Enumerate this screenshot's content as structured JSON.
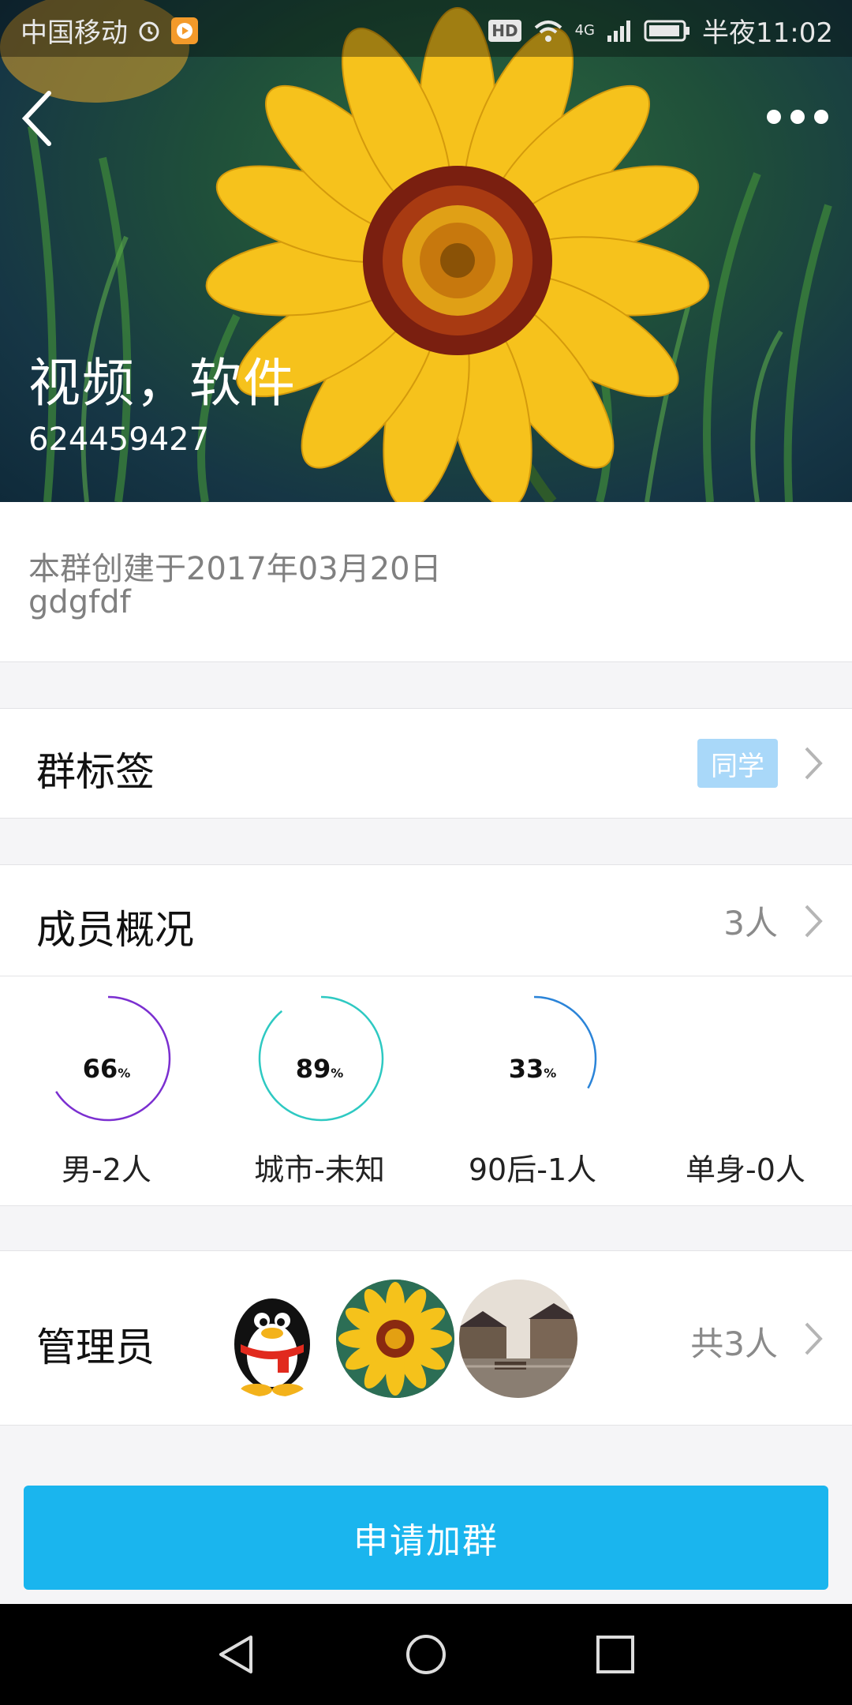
{
  "status_bar": {
    "carrier": "中国移动",
    "network": "4G",
    "hd": "HD",
    "time": "半夜11:02"
  },
  "header": {
    "group_name": "视频，软件",
    "group_id": "624459427"
  },
  "info": {
    "created": "本群创建于2017年03月20日",
    "description": "gdgfdf"
  },
  "tags_row": {
    "title": "群标签",
    "tag": "同学"
  },
  "members_row": {
    "title": "成员概况",
    "count": "3人"
  },
  "stats": [
    {
      "value": 66,
      "unit": "%",
      "label": "男-2人",
      "color": "#7b2fd0"
    },
    {
      "value": 89,
      "unit": "%",
      "label": "城市-未知",
      "color": "#2ec9c2"
    },
    {
      "value": 33,
      "unit": "%",
      "label": "90后-1人",
      "color": "#2b84d8"
    },
    {
      "label": "单身-0人"
    }
  ],
  "admins": {
    "title": "管理员",
    "avatars": [
      "qq-penguin",
      "yellow-flower",
      "water-town"
    ],
    "total": "共3人"
  },
  "join_button": "申请加群",
  "colors": {
    "accent": "#1ab5ee",
    "tag_bg": "#a9d8f9"
  },
  "nav": [
    "back-triangle-icon",
    "home-circle-icon",
    "recents-square-icon"
  ]
}
